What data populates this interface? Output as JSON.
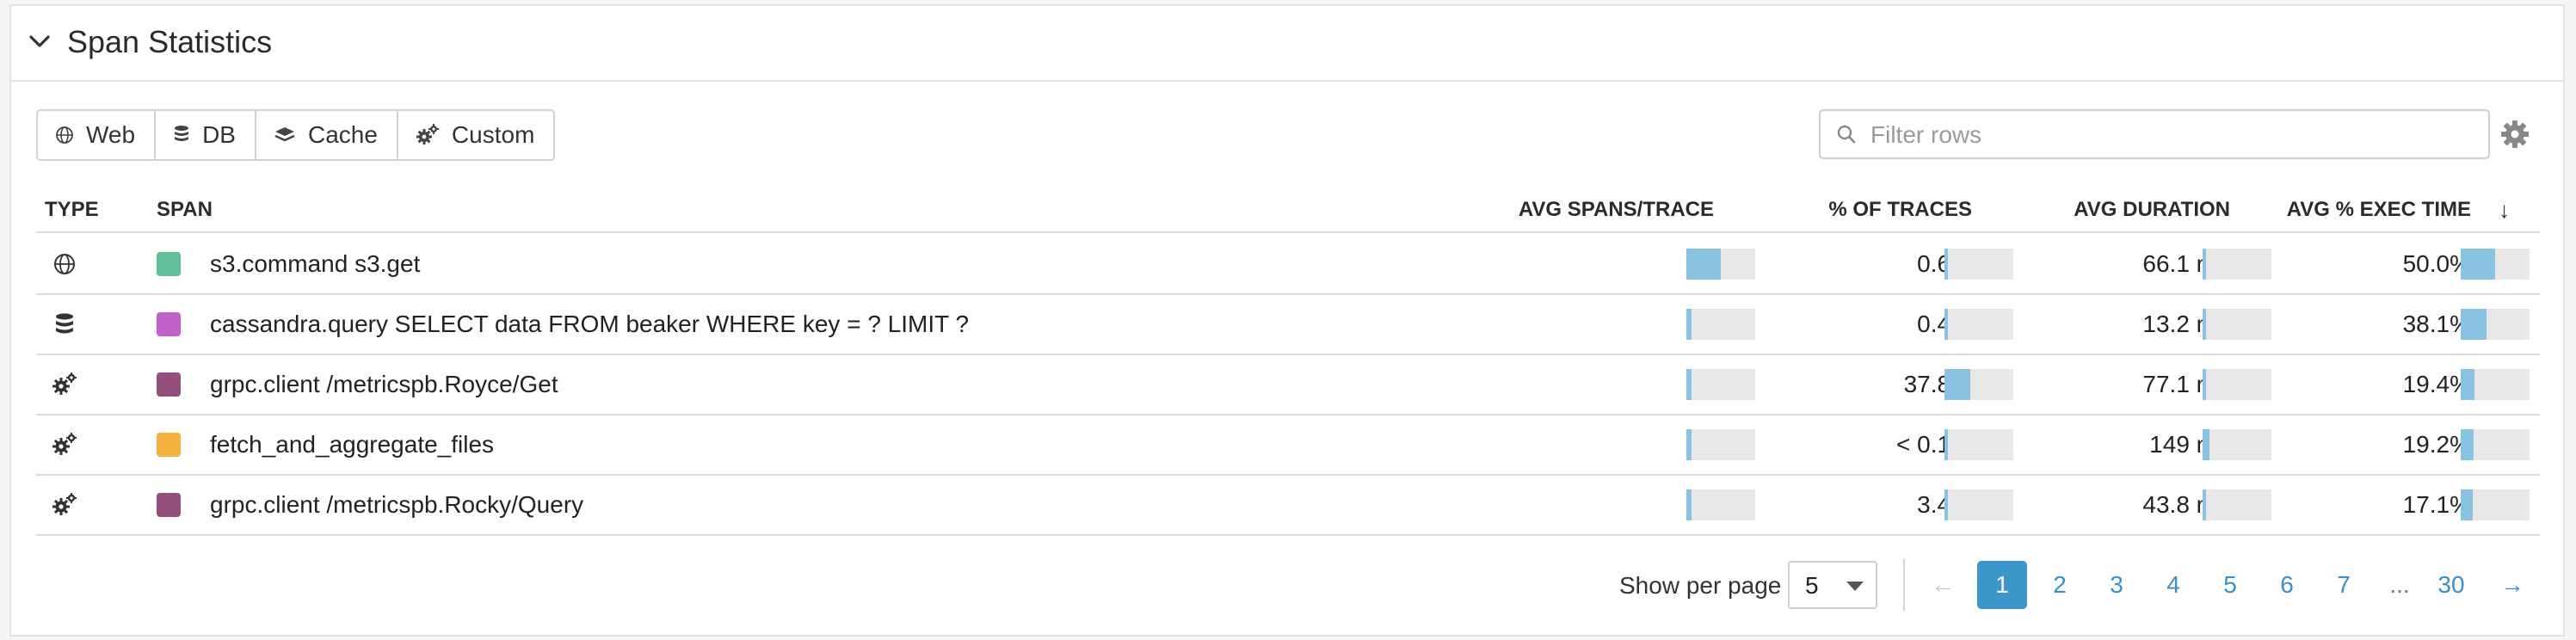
{
  "panel": {
    "title": "Span Statistics"
  },
  "filters": {
    "buttons": [
      {
        "label": "Web",
        "icon": "globe-icon"
      },
      {
        "label": "DB",
        "icon": "database-icon"
      },
      {
        "label": "Cache",
        "icon": "layers-icon"
      },
      {
        "label": "Custom",
        "icon": "cogs-icon"
      }
    ],
    "search_placeholder": "Filter rows"
  },
  "table": {
    "headers": {
      "type": "TYPE",
      "span": "SPAN",
      "avg_spans": "AVG SPANS/TRACE",
      "pct_traces": "% OF TRACES",
      "avg_duration": "AVG DURATION",
      "avg_exec": "AVG % EXEC TIME",
      "sort_indicator": "↓"
    },
    "rows": [
      {
        "type_icon": "globe-icon",
        "color": "#5fbf98",
        "span": "s3.command s3.get",
        "avg_spans": "7",
        "avg_spans_fill": 0.5,
        "pct_traces": "0.6%",
        "pct_traces_fill": 0.006,
        "avg_duration": "66.1 ms",
        "avg_duration_fill": 0.05,
        "avg_exec": "50.0%",
        "avg_exec_fill": 0.5
      },
      {
        "type_icon": "database-icon",
        "color": "#c062c8",
        "span": "cassandra.query SELECT data FROM beaker WHERE key = ? LIMIT ?",
        "avg_spans": "1",
        "avg_spans_fill": 0.07,
        "pct_traces": "0.4%",
        "pct_traces_fill": 0.004,
        "avg_duration": "13.2 ms",
        "avg_duration_fill": 0.04,
        "avg_exec": "38.1%",
        "avg_exec_fill": 0.381
      },
      {
        "type_icon": "cogs-icon",
        "color": "#944f7d",
        "span": "grpc.client /metricspb.Royce/Get",
        "avg_spans": "1",
        "avg_spans_fill": 0.07,
        "pct_traces": "37.8%",
        "pct_traces_fill": 0.378,
        "avg_duration": "77.1 ms",
        "avg_duration_fill": 0.05,
        "avg_exec": "19.4%",
        "avg_exec_fill": 0.194
      },
      {
        "type_icon": "cogs-icon",
        "color": "#f6b33f",
        "span": "fetch_and_aggregate_files",
        "avg_spans": "1",
        "avg_spans_fill": 0.07,
        "pct_traces": "< 0.1%",
        "pct_traces_fill": 0.001,
        "avg_duration": "149 ms",
        "avg_duration_fill": 0.1,
        "avg_exec": "19.2%",
        "avg_exec_fill": 0.192
      },
      {
        "type_icon": "cogs-icon",
        "color": "#944f7d",
        "span": "grpc.client /metricspb.Rocky/Query",
        "avg_spans": "1",
        "avg_spans_fill": 0.07,
        "pct_traces": "3.4%",
        "pct_traces_fill": 0.034,
        "avg_duration": "43.8 ms",
        "avg_duration_fill": 0.05,
        "avg_exec": "17.1%",
        "avg_exec_fill": 0.171
      }
    ]
  },
  "pagination": {
    "per_page_label": "Show per page",
    "per_page_value": "5",
    "prev": "←",
    "next": "→",
    "pages": [
      "1",
      "2",
      "3",
      "4",
      "5",
      "6",
      "7",
      "...",
      "30"
    ],
    "current": "1"
  }
}
